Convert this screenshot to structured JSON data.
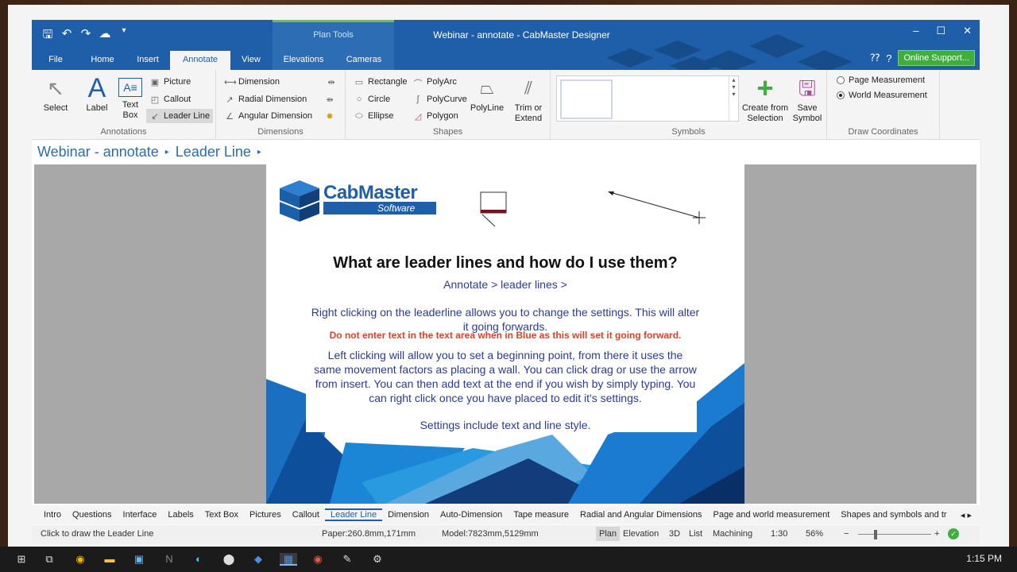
{
  "window": {
    "title": "Webinar - annotate - CabMaster Designer",
    "context_tab": "Plan Tools",
    "minimize": "–",
    "maximize": "☐",
    "close": "✕"
  },
  "tabs": [
    "File",
    "Home",
    "Insert",
    "Annotate",
    "View",
    "Elevations",
    "Cameras"
  ],
  "online_support": "Online Support...",
  "ribbon": {
    "annotations": {
      "label": "Annotations",
      "select": "Select",
      "label_btn": "Label",
      "textbox": "Text Box",
      "picture": "Picture",
      "callout": "Callout",
      "leader_line": "Leader Line"
    },
    "dimensions": {
      "label": "Dimensions",
      "dimension": "Dimension",
      "radial": "Radial Dimension",
      "angular": "Angular Dimension"
    },
    "shapes": {
      "label": "Shapes",
      "rectangle": "Rectangle",
      "circle": "Circle",
      "ellipse": "Ellipse",
      "polyarc": "PolyArc",
      "polycurve": "PolyCurve",
      "polygon": "Polygon",
      "polyline": "PolyLine",
      "trim": "Trim or Extend"
    },
    "symbols": {
      "label": "Symbols",
      "create": "Create from Selection",
      "save": "Save Symbol"
    },
    "draw_coordinates": {
      "label": "Draw Coordinates",
      "page": "Page Measurement",
      "world": "World Measurement"
    }
  },
  "breadcrumb": [
    "Webinar - annotate",
    "Leader Line"
  ],
  "slide": {
    "logo_main": "CabMaster",
    "logo_sub": "Software",
    "heading": "What are leader lines and how do I use them?",
    "sub": "Annotate > leader lines >",
    "p1": "Right clicking on the leaderline allows you to change the settings. This will alter it going forwards.",
    "warning": "Do not enter text in the text area when in Blue as this will set it going forward.",
    "p2": "Left clicking will allow you to set a beginning point, from there it uses the same movement factors as placing a wall. You can click drag or use the arrow from insert. You can then add text at the end if you wish by simply typing. You can right click once you have placed to edit it's settings.",
    "p3": "Settings include text and line style."
  },
  "bottom_tabs": [
    "Intro",
    "Questions",
    "Interface",
    "Labels",
    "Text Box",
    "Pictures",
    "Callout",
    "Leader Line",
    "Dimension",
    "Auto-Dimension",
    "Tape measure",
    "Radial and Angular Dimensions",
    "Page and world measurement",
    "Shapes and symbols and tr"
  ],
  "active_bottom_tab": "Leader Line",
  "status": {
    "hint": "Click to draw the Leader Line",
    "paper": "Paper:260.8mm,171mm",
    "model": "Model:7823mm,5129mm",
    "views": [
      "Plan",
      "Elevation",
      "3D",
      "List",
      "Machining"
    ],
    "scale": "1:30",
    "zoom": "56%"
  },
  "clock": "1:15 PM",
  "colors": {
    "accent": "#1f5fa9",
    "warning": "#e0402a",
    "text_blue": "#2a3a9c",
    "green": "#3fae3f"
  }
}
